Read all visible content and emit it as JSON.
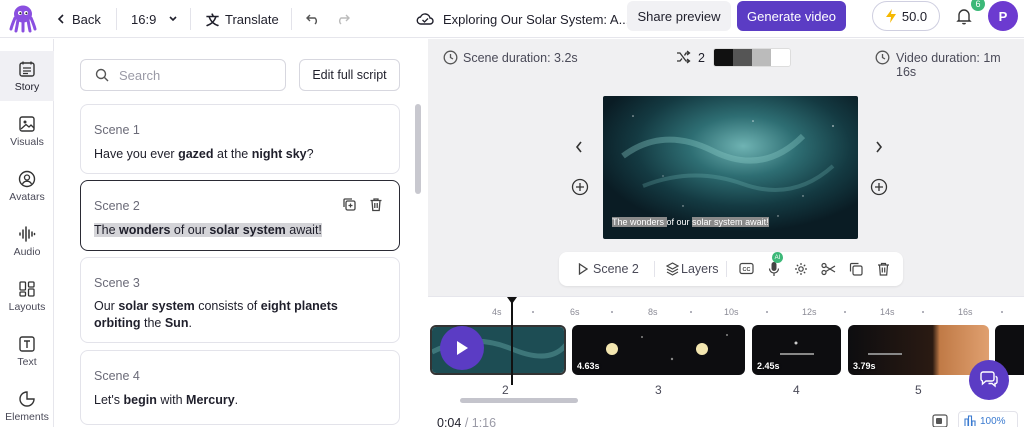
{
  "topbar": {
    "back_label": "Back",
    "aspect_ratio": "16:9",
    "translate_label": "Translate",
    "project_title": "Exploring Our Solar System: A...",
    "share_preview_label": "Share preview",
    "generate_video_label": "Generate video",
    "credits": "50.0",
    "notification_count": "6",
    "avatar_initial": "P"
  },
  "nav": {
    "items": [
      {
        "label": "Story",
        "icon": "story-icon",
        "active": true
      },
      {
        "label": "Visuals",
        "icon": "image-icon"
      },
      {
        "label": "Avatars",
        "icon": "avatar-icon"
      },
      {
        "label": "Audio",
        "icon": "audio-wave-icon"
      },
      {
        "label": "Layouts",
        "icon": "layout-grid-icon"
      },
      {
        "label": "Text",
        "icon": "text-icon"
      },
      {
        "label": "Elements",
        "icon": "elements-icon"
      }
    ]
  },
  "script_panel": {
    "search_placeholder": "Search",
    "edit_full_script_label": "Edit full script",
    "scenes": [
      {
        "title": "Scene 1",
        "text_parts": [
          [
            "Have you ever ",
            false
          ],
          [
            "gazed",
            true
          ],
          [
            " at the ",
            false
          ],
          [
            "night sky",
            true
          ],
          [
            "?",
            false
          ]
        ]
      },
      {
        "title": "Scene 2",
        "text_parts": [
          [
            "The ",
            false
          ],
          [
            "wonders",
            true
          ],
          [
            " of our ",
            false
          ],
          [
            "solar system",
            true
          ],
          [
            " await!",
            false
          ]
        ]
      },
      {
        "title": "Scene 3",
        "text_parts": [
          [
            "Our ",
            false
          ],
          [
            "solar system",
            true
          ],
          [
            " consists of ",
            false
          ],
          [
            "eight planets orbiting",
            true
          ],
          [
            " the ",
            false
          ],
          [
            "Sun",
            true
          ],
          [
            ".",
            false
          ]
        ]
      },
      {
        "title": "Scene 4",
        "text_parts": [
          [
            "Let's ",
            false
          ],
          [
            "begin",
            true
          ],
          [
            " with ",
            false
          ],
          [
            "Mercury",
            true
          ],
          [
            ".",
            false
          ]
        ]
      }
    ]
  },
  "preview": {
    "scene_duration": "Scene duration: 3.2s",
    "shuffle_count": "2",
    "video_duration": "Video duration: 1m 16s",
    "caption_parts": [
      "The wonders ",
      "of our ",
      "solar system",
      " await!"
    ],
    "toolbar": {
      "scene_label": "Scene 2",
      "layers_label": "Layers",
      "ai_badge": "AI"
    }
  },
  "timeline": {
    "ticks": [
      "4s",
      "6s",
      "8s",
      "10s",
      "12s",
      "14s",
      "16s"
    ],
    "clips": [
      {
        "number": "2",
        "duration": ""
      },
      {
        "number": "3",
        "duration": "4.63s"
      },
      {
        "number": "4",
        "duration": "2.45s"
      },
      {
        "number": "5",
        "duration": "3.79s"
      }
    ],
    "current_time": "0:04",
    "total_time": " / 1:16",
    "zoom": "100%"
  }
}
